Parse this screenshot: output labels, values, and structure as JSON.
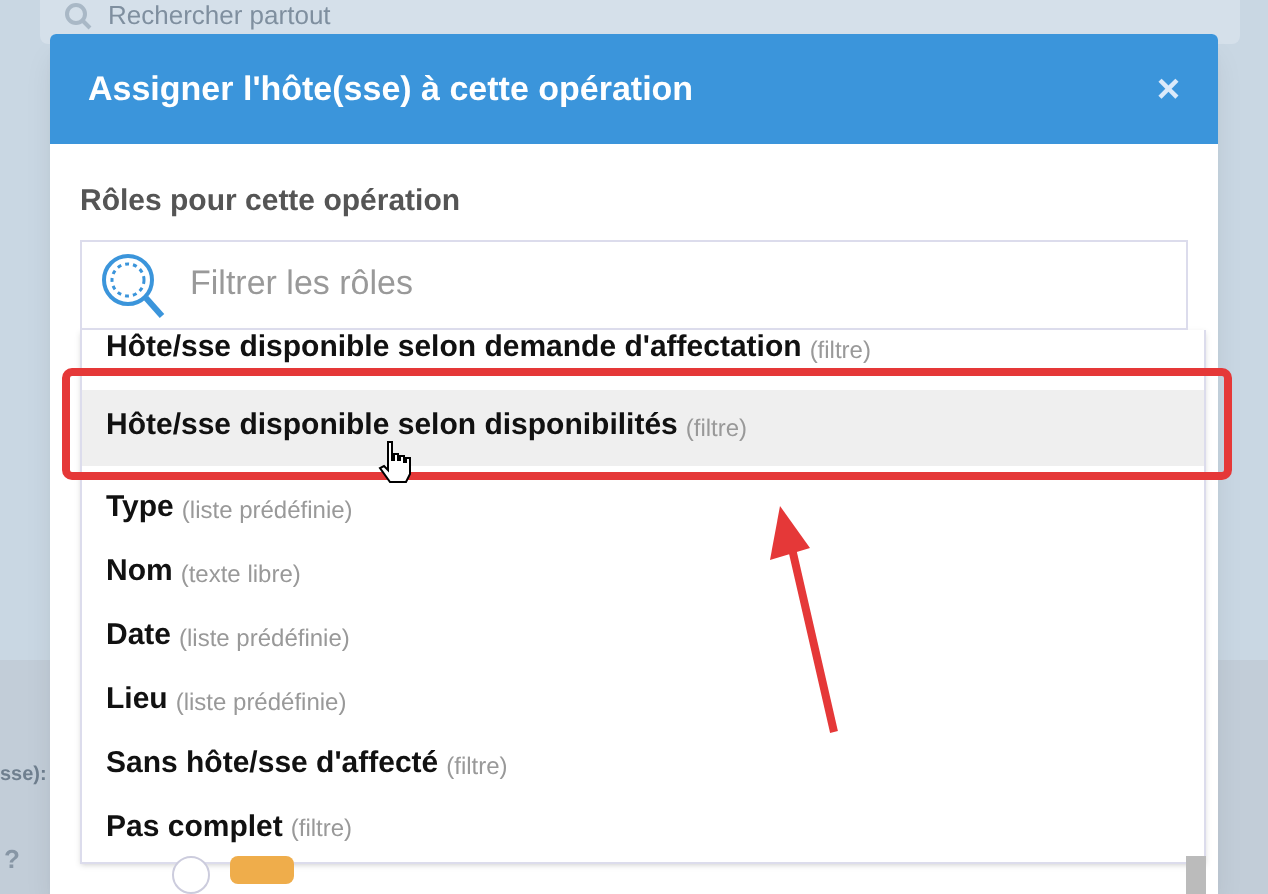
{
  "background": {
    "search_placeholder": "Rechercher partout",
    "left_labels": [
      "sse):",
      "?"
    ],
    "checkbox": {
      "checked": false
    }
  },
  "dialog": {
    "title": "Assigner l'hôte(sse) à cette opération",
    "close": "×",
    "field_label": "Rôles pour cette opération",
    "filter": {
      "placeholder": "Filtrer les rôles"
    },
    "options": [
      {
        "name": "Hôte/sse disponible selon demande d'affectation",
        "hint": "(filtre)",
        "selected": false
      },
      {
        "name": "Hôte/sse disponible selon disponibilités",
        "hint": "(filtre)",
        "selected": true
      },
      {
        "name": "Type",
        "hint": "(liste prédéfinie)",
        "selected": false
      },
      {
        "name": "Nom",
        "hint": "(texte libre)",
        "selected": false
      },
      {
        "name": "Date",
        "hint": "(liste prédéfinie)",
        "selected": false
      },
      {
        "name": "Lieu",
        "hint": "(liste prédéfinie)",
        "selected": false
      },
      {
        "name": "Sans hôte/sse d'affecté",
        "hint": "(filtre)",
        "selected": false
      },
      {
        "name": "Pas complet",
        "hint": "(filtre)",
        "selected": false
      }
    ]
  }
}
